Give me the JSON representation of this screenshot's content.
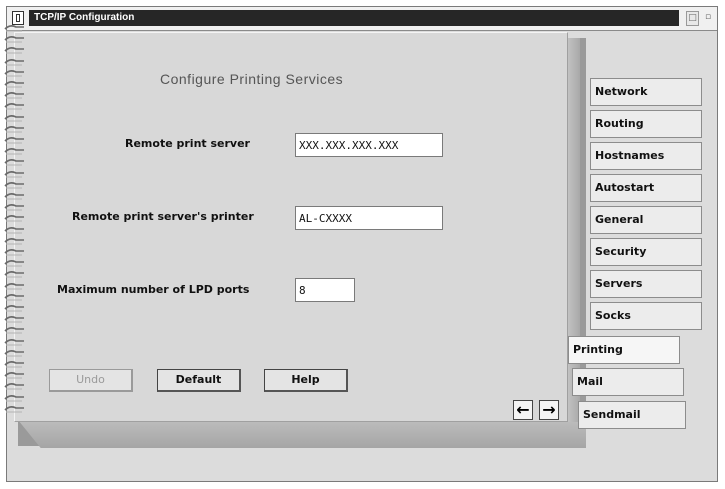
{
  "window": {
    "title": "TCP/IP Configuration",
    "restore_glyph": "□",
    "minimize_glyph": "▫"
  },
  "page": {
    "title": "Configure  Printing  Services"
  },
  "form": {
    "remote_server_label": "Remote print server",
    "remote_server_value": "XXX.XXX.XXX.XXX",
    "remote_printer_label": "Remote print server's printer",
    "remote_printer_value": "AL-CXXXX",
    "max_lpd_label": "Maximum number of LPD ports",
    "max_lpd_value": "8"
  },
  "buttons": {
    "undo": "Undo",
    "default": "Default",
    "help": "Help",
    "prev_glyph": "←",
    "next_glyph": "→"
  },
  "tabs": [
    {
      "label": "Network"
    },
    {
      "label": "Routing"
    },
    {
      "label": "Hostnames"
    },
    {
      "label": "Autostart"
    },
    {
      "label": "General"
    },
    {
      "label": "Security"
    },
    {
      "label": "Servers"
    },
    {
      "label": "Socks"
    },
    {
      "label": "Printing"
    },
    {
      "label": "Mail"
    },
    {
      "label": "Sendmail"
    }
  ],
  "active_tab": "Printing",
  "colors": {
    "title_bar": "#262626",
    "page": "#d8d8d8",
    "field": "#ffffff"
  }
}
